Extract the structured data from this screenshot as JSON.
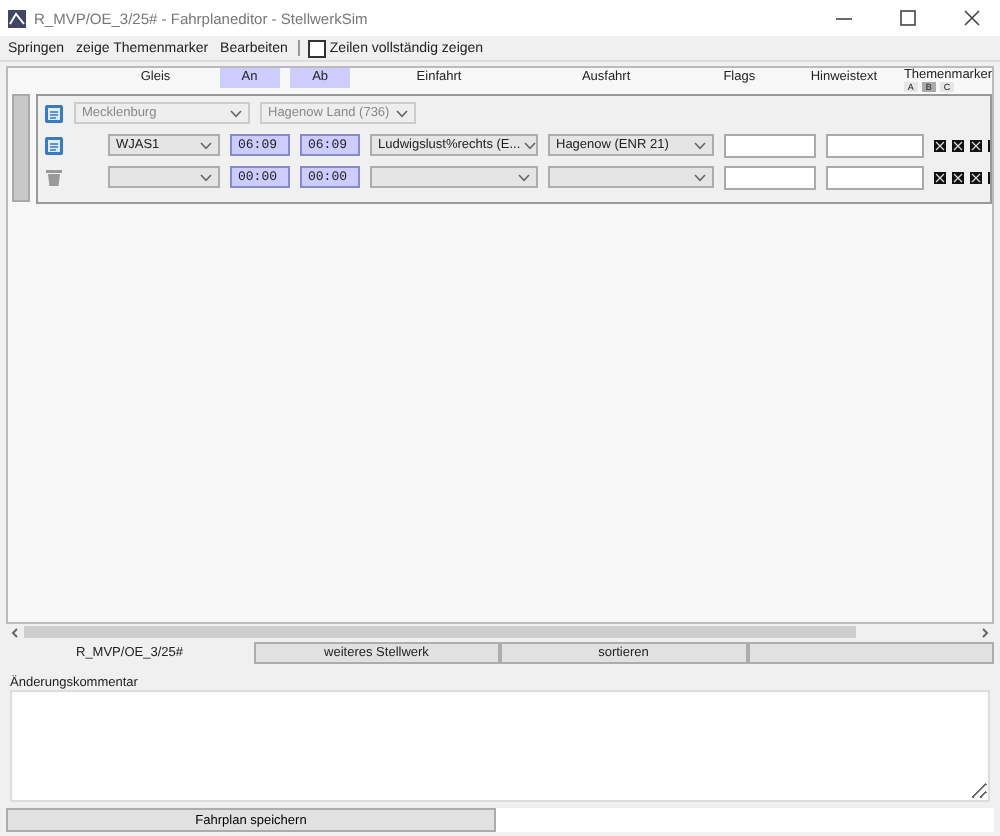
{
  "window": {
    "title": "R_MVP/OE_3/25# - Fahrplaneditor - StellwerkSim"
  },
  "menu": {
    "items": [
      "Springen",
      "zeige Themenmarker",
      "Bearbeiten"
    ],
    "checkbox": {
      "label": "Zeilen vollständig zeigen",
      "checked": false
    }
  },
  "columns": [
    {
      "label": "Gleis",
      "kind": "text"
    },
    {
      "label": "An",
      "kind": "time"
    },
    {
      "label": "Ab",
      "kind": "time"
    },
    {
      "label": "Einfahrt",
      "kind": "text"
    },
    {
      "label": "Ausfahrt",
      "kind": "text"
    },
    {
      "label": "Flags",
      "kind": "text"
    },
    {
      "label": "Hinweistext",
      "kind": "text"
    },
    {
      "label": "Themenmarker",
      "kind": "markers"
    }
  ],
  "marker_columns": [
    {
      "label": "A",
      "selected": false
    },
    {
      "label": "B",
      "selected": true
    },
    {
      "label": "C",
      "selected": false
    }
  ],
  "group": {
    "region": "Mecklenburg",
    "station": "Hagenow Land (736)",
    "disabled": true
  },
  "stops": [
    {
      "kind": "stop",
      "gleis": "WJAS1",
      "an": "06:09",
      "ab": "06:09",
      "einfahrt": "Ludwigslust%rechts (E...",
      "ausfahrt": "Hagenow (ENR 21)"
    },
    {
      "kind": "new",
      "an": "00:00",
      "ab": "00:00"
    }
  ],
  "tabs": [
    {
      "label": "R_MVP/OE_3/25#",
      "selected": true
    },
    {
      "label": "weiteres Stellwerk",
      "selected": false
    },
    {
      "label": "sortieren",
      "selected": false
    }
  ],
  "comment": {
    "label": "Änderungskommentar"
  },
  "save_button": "Fahrplan speichern"
}
